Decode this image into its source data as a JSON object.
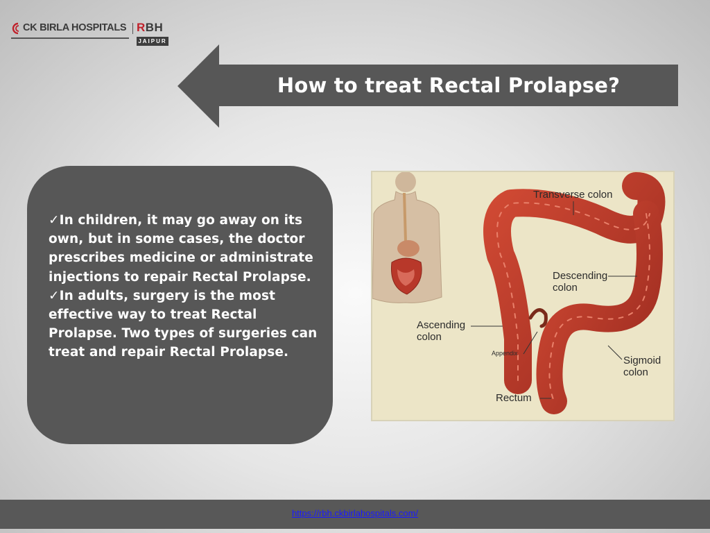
{
  "logo": {
    "hospital_name": "CK BIRLA HOSPITALS",
    "rbh_prefix": "R",
    "rbh_rest": "BH",
    "city": "JAIPUR"
  },
  "slide": {
    "title": "How to treat Rectal Prolapse?",
    "bullets": [
      "✓In children, it may go away on its own, but in some cases, the doctor prescribes medicine or administrate injections to repair Rectal Prolapse.",
      "✓In adults, surgery is the most effective way to treat Rectal Prolapse. Two types of surgeries can treat and repair Rectal Prolapse."
    ]
  },
  "figure": {
    "labels": {
      "transverse": "Transverse colon",
      "descending_1": "Descending",
      "descending_2": "colon",
      "ascending_1": "Ascending",
      "ascending_2": "colon",
      "appendix": "Appendix",
      "sigmoid_1": "Sigmoid",
      "sigmoid_2": "colon",
      "rectum": "Rectum"
    }
  },
  "footer": {
    "link": "https://rbh.ckbirlahospitals.com/"
  },
  "colors": {
    "panel": "#575757",
    "accent_red": "#c0202a",
    "colon": "#b8382a",
    "figure_bg": "#ece5c7",
    "link": "#1a1aff"
  }
}
